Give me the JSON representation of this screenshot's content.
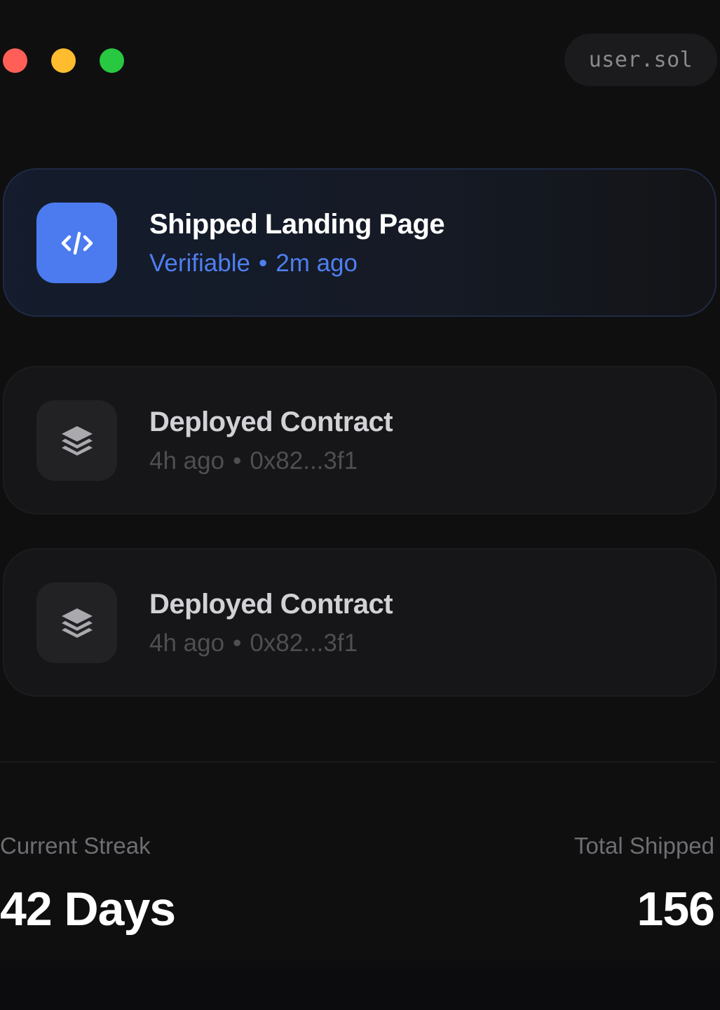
{
  "header": {
    "window_controls": [
      "close",
      "minimize",
      "maximize"
    ],
    "user_label": "user.sol"
  },
  "activity": [
    {
      "title": "Shipped Landing Page",
      "status": "Verifiable",
      "time": "2m ago",
      "icon": "code-icon",
      "active": true
    },
    {
      "title": "Deployed Contract",
      "time": "4h ago",
      "hash": "0x82...3f1",
      "icon": "layers-icon",
      "active": false
    },
    {
      "title": "Deployed Contract",
      "time": "4h ago",
      "hash": "0x82...3f1",
      "icon": "layers-icon",
      "active": false
    }
  ],
  "stats": {
    "streak_label": "Current Streak",
    "streak_value": "42 Days",
    "shipped_label": "Total Shipped",
    "shipped_value": "156"
  },
  "colors": {
    "background": "#0f0f10",
    "accent": "#4b7bef",
    "close": "#ff5f57",
    "minimize": "#febc2e",
    "maximize": "#28c840"
  },
  "separator": "•"
}
